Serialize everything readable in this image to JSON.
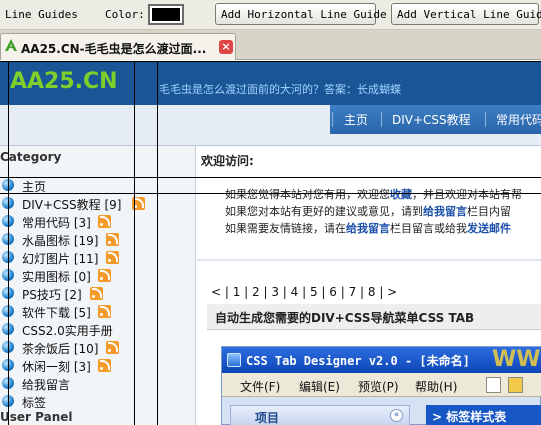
{
  "toolbar": {
    "line_guides_label": "Line Guides",
    "color_label": "Color:",
    "color_value": "#000000",
    "add_horizontal_label": "Add Horizontal Line Guide",
    "add_vertical_label": "Add Vertical Line Guide"
  },
  "browser": {
    "tab_title": "AA25.CN-毛毛虫是怎么渡过面...",
    "tab_close_icon": "close-icon",
    "favicon": "green-a-icon"
  },
  "site": {
    "logo": "AA25.CN",
    "tagline": "毛毛虫是怎么渡过面前的大河的？答案：长成蝴蝶",
    "nav": [
      "主页",
      "DIV+CSS教程",
      "常用代码"
    ]
  },
  "sidebar": {
    "category_heading": "Category",
    "user_panel_heading": "User Panel",
    "items": [
      {
        "label": "主页",
        "rss": false
      },
      {
        "label": "DIV+CSS教程 [9]",
        "rss": true
      },
      {
        "label": "常用代码 [3]",
        "rss": true
      },
      {
        "label": "水晶图标 [19]",
        "rss": true
      },
      {
        "label": "幻灯图片 [11]",
        "rss": true
      },
      {
        "label": "实用图标 [0]",
        "rss": true
      },
      {
        "label": "PS技巧 [2]",
        "rss": true
      },
      {
        "label": "软件下载 [5]",
        "rss": true
      },
      {
        "label": "CSS2.0实用手册",
        "rss": false
      },
      {
        "label": "茶余饭后 [10]",
        "rss": true
      },
      {
        "label": "休闲一刻 [3]",
        "rss": true
      },
      {
        "label": "给我留言",
        "rss": false
      },
      {
        "label": "标签",
        "rss": false
      }
    ]
  },
  "main": {
    "welcome_title": "欢迎访问:",
    "welcome_lines": [
      {
        "pre": "如果您觉得本站对您有用，欢迎您",
        "bold": "收藏",
        "post": "，并且欢迎对本站有帮"
      },
      {
        "pre": "如果您对本站有更好的建议或意见，请到",
        "bold": "给我留言",
        "post": "栏目内留"
      },
      {
        "pre": "如果需要友情链接，请在",
        "bold": "给我留言",
        "post": "栏目留言或给我",
        "bold2": "发送邮件"
      }
    ],
    "pagination": "< | 1 | 2 | 3 | 4 | 5 | 6 | 7 | 8 | >",
    "article_title": "自动生成您需要的DIV+CSS导航菜单CSS TAB"
  },
  "app_screenshot": {
    "title": "CSS Tab Designer v2.0 - [未命名]",
    "watermark": "WW",
    "menus": [
      "文件(F)",
      "编辑(E)",
      "预览(P)",
      "帮助(H)"
    ],
    "left_panel_label": "项目",
    "right_panel_label": "> 标签样式表"
  },
  "colors": {
    "header_blue": "#1a5596",
    "logo_green": "#7fcf2a",
    "link_blue": "#1a4fa8",
    "rss_orange": "#f39a2b",
    "guide_line": "#000000"
  }
}
